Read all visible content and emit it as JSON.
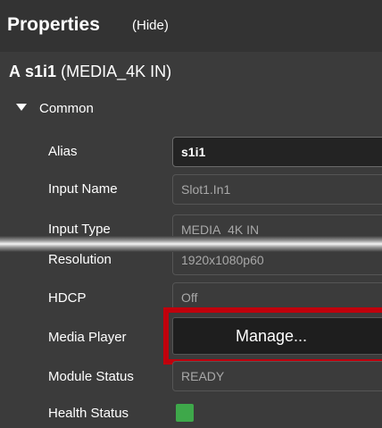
{
  "panel": {
    "title": "Properties",
    "hide_label": "(Hide)"
  },
  "object": {
    "prefix": "A",
    "name": "s1i1",
    "type": "(MEDIA_4K IN)"
  },
  "section": {
    "label": "Common",
    "expanded": true
  },
  "rows": {
    "alias": {
      "label": "Alias",
      "value": "s1i1"
    },
    "input_name": {
      "label": "Input Name",
      "value": "Slot1.In1"
    },
    "input_type": {
      "label": "Input Type",
      "value": "MEDIA_4K IN"
    },
    "resolution": {
      "label": "Resolution",
      "value": "1920x1080p60"
    },
    "hdcp": {
      "label": "HDCP",
      "value": "Off"
    },
    "media_player": {
      "label": "Media Player",
      "button_label": "Manage..."
    },
    "module_status": {
      "label": "Module Status",
      "value": "READY"
    },
    "health_status": {
      "label": "Health Status",
      "indicator_color": "#3ea84a"
    }
  },
  "colors": {
    "background": "#3b3b3b",
    "header": "#333333",
    "highlight": "#c0000c",
    "status_ok": "#3ea84a"
  }
}
